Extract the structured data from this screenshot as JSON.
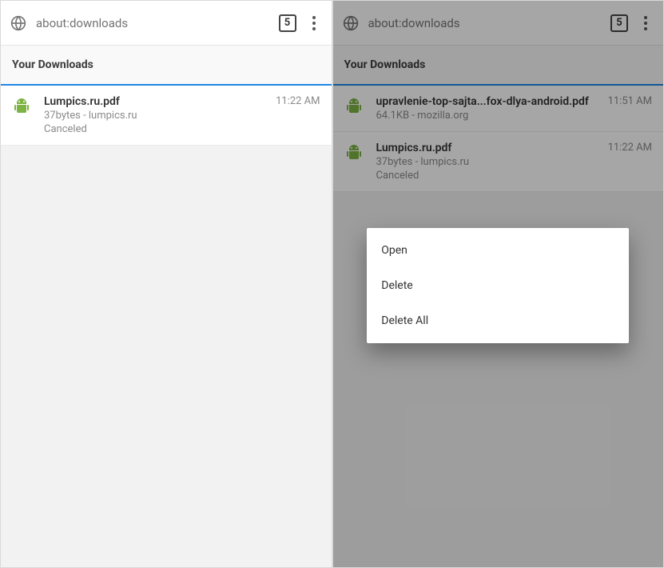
{
  "url": "about:downloads",
  "tab_count": "5",
  "section_title": "Your Downloads",
  "left": {
    "items": [
      {
        "title": "Lumpics.ru.pdf",
        "subtitle": "37bytes -  lumpics.ru",
        "status": "Canceled",
        "time": "11:22 AM"
      }
    ]
  },
  "right": {
    "items": [
      {
        "title": "upravlenie-top-sajta...fox-dlya-android.pdf",
        "subtitle": "64.1KB -  mozilla.org",
        "status": "",
        "time": "11:51 AM"
      },
      {
        "title": "Lumpics.ru.pdf",
        "subtitle": "37bytes -  lumpics.ru",
        "status": "Canceled",
        "time": "11:22 AM"
      }
    ]
  },
  "menu": {
    "open": "Open",
    "delete": "Delete",
    "delete_all": "Delete All"
  }
}
